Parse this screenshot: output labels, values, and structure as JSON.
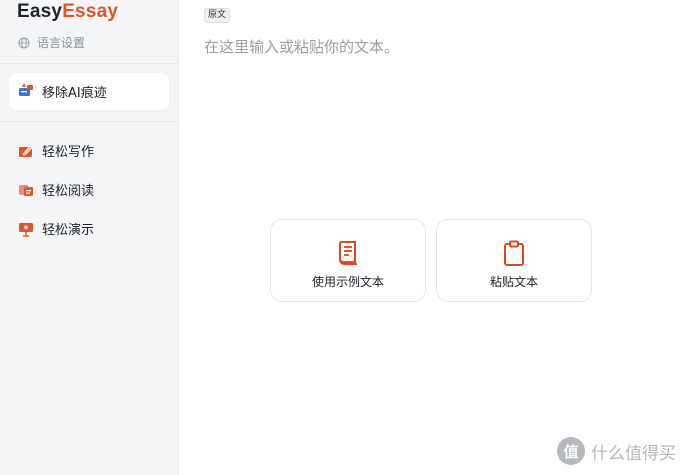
{
  "sidebar": {
    "logo_part1": "Easy",
    "logo_part2": "Essay",
    "language_setting": "语言设置",
    "active_item": {
      "label": "移除AI痕迹",
      "icon": "ai-remove-icon"
    },
    "items": [
      {
        "label": "轻松写作",
        "icon": "pencil-icon"
      },
      {
        "label": "轻松阅读",
        "icon": "reading-icon"
      },
      {
        "label": "轻松演示",
        "icon": "presentation-icon"
      }
    ]
  },
  "main": {
    "tag": "原文",
    "placeholder": "在这里输入或粘贴你的文本。",
    "cards": [
      {
        "label": "使用示例文本",
        "icon": "document-icon"
      },
      {
        "label": "粘贴文本",
        "icon": "clipboard-icon"
      }
    ]
  },
  "watermark": {
    "badge": "值",
    "text": "什么值得买"
  },
  "colors": {
    "accent": "#e0542c",
    "sidebar_bg": "#f3f5f7",
    "text": "#1f2329",
    "muted": "#9a9fa6"
  }
}
